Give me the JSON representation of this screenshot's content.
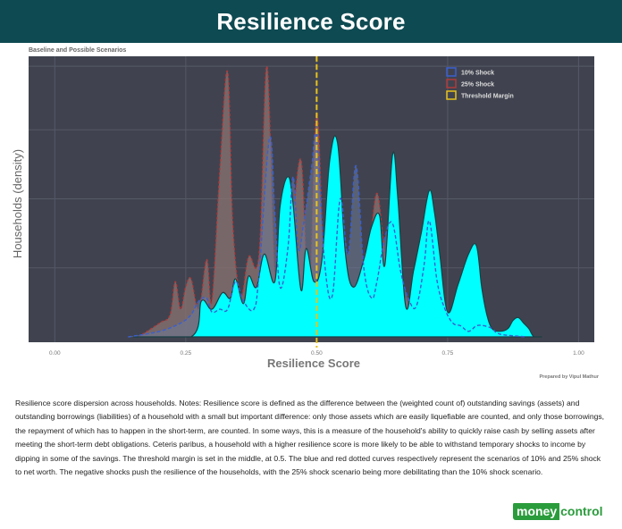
{
  "header": {
    "title": "Resilience Score"
  },
  "caption": "Resilience score dispersion across households. Notes: Resilience score is defined as the difference between the (weighted count of) outstanding savings (assets) and outstanding borrowings (liabilities) of a household with a small but important difference: only those assets which are easily liquefiable are counted, and only those borrowings, the repayment of which has to happen in the short-term, are counted. In some ways, this is a measure of the household's ability to quickly raise cash by selling assets after meeting the short-term debt obligations. Ceteris paribus, a household with a higher resilience score is more likely to be able to withstand temporary shocks to income by dipping in some of the savings. The threshold margin is set in the middle, at 0.5. The blue and red dotted curves respectively represent the scenarios of 10% and 25% shock to net worth. The negative shocks push the resilience of the households, with the 25% shock scenario being more debilitating than the 10% shock scenario.",
  "logo": {
    "part1": "money",
    "part2": "control"
  },
  "colors": {
    "panel": "#40434f",
    "baseline_fill": "#00ffff",
    "shock10": "#3a5fd0",
    "shock25": "#b03a3a",
    "threshold": "#e8c21a",
    "header": "#0e4a52"
  },
  "chart_data": {
    "type": "area",
    "title": "Baseline and Possible Scenarios",
    "xlabel": "Resilience Score",
    "ylabel": "Households (density)",
    "credit": "Prepared by Vipul Mathur",
    "xlim": [
      -0.05,
      1.03
    ],
    "ylim": [
      0,
      1.0
    ],
    "x_ticks": [
      0.0,
      0.25,
      0.5,
      0.75,
      1.0
    ],
    "x_tick_labels": [
      "0.00",
      "0.25",
      "0.50",
      "0.75",
      "1.00"
    ],
    "threshold": 0.5,
    "legend": {
      "placement": "top-right",
      "entries": [
        "10% Shock",
        "25% Shock",
        "Threshold Margin"
      ]
    },
    "series": [
      {
        "name": "Baseline",
        "style": "filled",
        "x": [
          0.15,
          0.26,
          0.28,
          0.3,
          0.32,
          0.335,
          0.345,
          0.36,
          0.37,
          0.385,
          0.4,
          0.42,
          0.43,
          0.445,
          0.455,
          0.47,
          0.48,
          0.495,
          0.51,
          0.525,
          0.54,
          0.555,
          0.57,
          0.59,
          0.605,
          0.62,
          0.63,
          0.645,
          0.655,
          0.67,
          0.685,
          0.7,
          0.715,
          0.725,
          0.735,
          0.75,
          0.77,
          0.79,
          0.805,
          0.815,
          0.825,
          0.835,
          0.85,
          0.865,
          0.875,
          0.885,
          0.895,
          0.905,
          0.915,
          0.93
        ],
        "y": [
          0.0,
          0.0,
          0.13,
          0.1,
          0.16,
          0.14,
          0.21,
          0.12,
          0.22,
          0.18,
          0.3,
          0.2,
          0.47,
          0.58,
          0.48,
          0.17,
          0.32,
          0.2,
          0.28,
          0.64,
          0.7,
          0.3,
          0.18,
          0.28,
          0.4,
          0.44,
          0.26,
          0.66,
          0.5,
          0.11,
          0.24,
          0.38,
          0.53,
          0.45,
          0.3,
          0.09,
          0.19,
          0.3,
          0.33,
          0.18,
          0.08,
          0.03,
          0.02,
          0.03,
          0.06,
          0.07,
          0.05,
          0.03,
          0.0,
          0.0
        ]
      },
      {
        "name": "10% Shock",
        "style": "dotted",
        "x": [
          0.14,
          0.2,
          0.24,
          0.26,
          0.275,
          0.29,
          0.3,
          0.315,
          0.33,
          0.345,
          0.36,
          0.38,
          0.39,
          0.41,
          0.42,
          0.43,
          0.445,
          0.455,
          0.465,
          0.475,
          0.49,
          0.5,
          0.515,
          0.53,
          0.545,
          0.56,
          0.575,
          0.59,
          0.605,
          0.615,
          0.63,
          0.645,
          0.66,
          0.675,
          0.69,
          0.705,
          0.715,
          0.73,
          0.745,
          0.76,
          0.775,
          0.79,
          0.805,
          0.82,
          0.835,
          0.85,
          0.9
        ],
        "y": [
          0.0,
          0.02,
          0.05,
          0.08,
          0.13,
          0.14,
          0.09,
          0.1,
          0.1,
          0.2,
          0.13,
          0.1,
          0.23,
          0.72,
          0.45,
          0.18,
          0.32,
          0.58,
          0.32,
          0.41,
          0.61,
          0.72,
          0.27,
          0.15,
          0.5,
          0.3,
          0.62,
          0.25,
          0.14,
          0.2,
          0.36,
          0.41,
          0.24,
          0.14,
          0.11,
          0.26,
          0.42,
          0.2,
          0.1,
          0.05,
          0.04,
          0.02,
          0.04,
          0.04,
          0.03,
          0.01,
          0.0
        ]
      },
      {
        "name": "25% Shock",
        "style": "dotted",
        "x": [
          0.16,
          0.2,
          0.22,
          0.23,
          0.24,
          0.25,
          0.26,
          0.275,
          0.29,
          0.3,
          0.315,
          0.33,
          0.34,
          0.355,
          0.37,
          0.39,
          0.405,
          0.42,
          0.435,
          0.45,
          0.47,
          0.485,
          0.5,
          0.515,
          0.53,
          0.55,
          0.57,
          0.59,
          0.6,
          0.615,
          0.63,
          0.65,
          0.67,
          0.68,
          0.7
        ],
        "y": [
          0.0,
          0.05,
          0.08,
          0.2,
          0.1,
          0.18,
          0.21,
          0.1,
          0.28,
          0.13,
          0.6,
          0.96,
          0.4,
          0.15,
          0.29,
          0.3,
          0.98,
          0.23,
          0.36,
          0.35,
          0.64,
          0.12,
          0.81,
          0.2,
          0.14,
          0.14,
          0.08,
          0.29,
          0.31,
          0.52,
          0.3,
          0.08,
          0.14,
          0.02,
          0.0
        ]
      }
    ]
  }
}
